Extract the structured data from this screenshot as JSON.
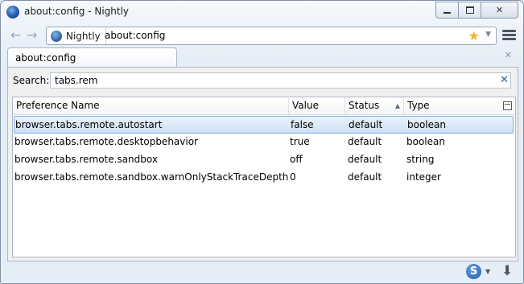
{
  "window": {
    "title": "about:config - Nightly"
  },
  "window_controls": {
    "minimize": "minimize",
    "maximize": "maximize",
    "close": "✕"
  },
  "nav": {
    "back_icon": "←",
    "forward_icon": "→",
    "identity_label": "Nightly",
    "url": "about:config",
    "bookmark_icon": "★",
    "dropmarker_icon": "▼"
  },
  "tab": {
    "label": "about:config",
    "close_icon": "✕"
  },
  "search": {
    "label": "Search:",
    "value": "tabs.rem",
    "clear_icon": "✕"
  },
  "columns": {
    "name": "Preference Name",
    "value": "Value",
    "status": "Status",
    "type": "Type",
    "sort_arrow": "▲"
  },
  "rows": [
    {
      "name": "browser.tabs.remote.autostart",
      "value": "false",
      "status": "default",
      "type": "boolean"
    },
    {
      "name": "browser.tabs.remote.desktopbehavior",
      "value": "true",
      "status": "default",
      "type": "boolean"
    },
    {
      "name": "browser.tabs.remote.sandbox",
      "value": "off",
      "status": "default",
      "type": "string"
    },
    {
      "name": "browser.tabs.remote.sandbox.warnOnlyStackTraceDepth",
      "value": "0",
      "status": "default",
      "type": "integer"
    }
  ],
  "statusbar": {
    "sync_icon_letter": "S",
    "dropmarker_icon": "▼",
    "download_icon": "⬇"
  },
  "colors": {
    "selected_row": "#cfe1f6",
    "accent": "#2a5fa8"
  }
}
